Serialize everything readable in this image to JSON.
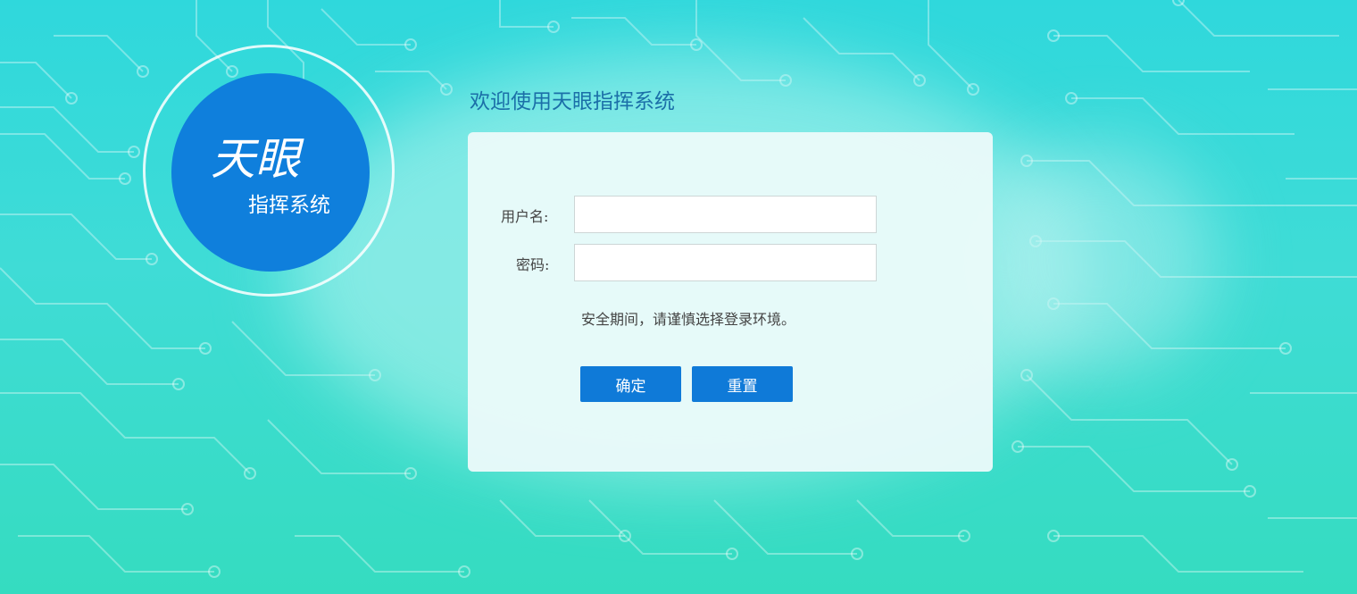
{
  "logo": {
    "main_text": "天眼",
    "sub_text": "指挥系统"
  },
  "welcome_title": "欢迎使用天眼指挥系统",
  "form": {
    "username_label": "用户名:",
    "username_value": "",
    "password_label": "密码:",
    "password_value": "",
    "notice": "安全期间，请谨慎选择登录环境。",
    "confirm_label": "确定",
    "reset_label": "重置"
  },
  "colors": {
    "accent": "#0f7ad8",
    "logo_blue": "#0f7fdc",
    "background": "#2fd8dc",
    "panel": "#eafafa",
    "title_text": "#1b6fa8"
  }
}
